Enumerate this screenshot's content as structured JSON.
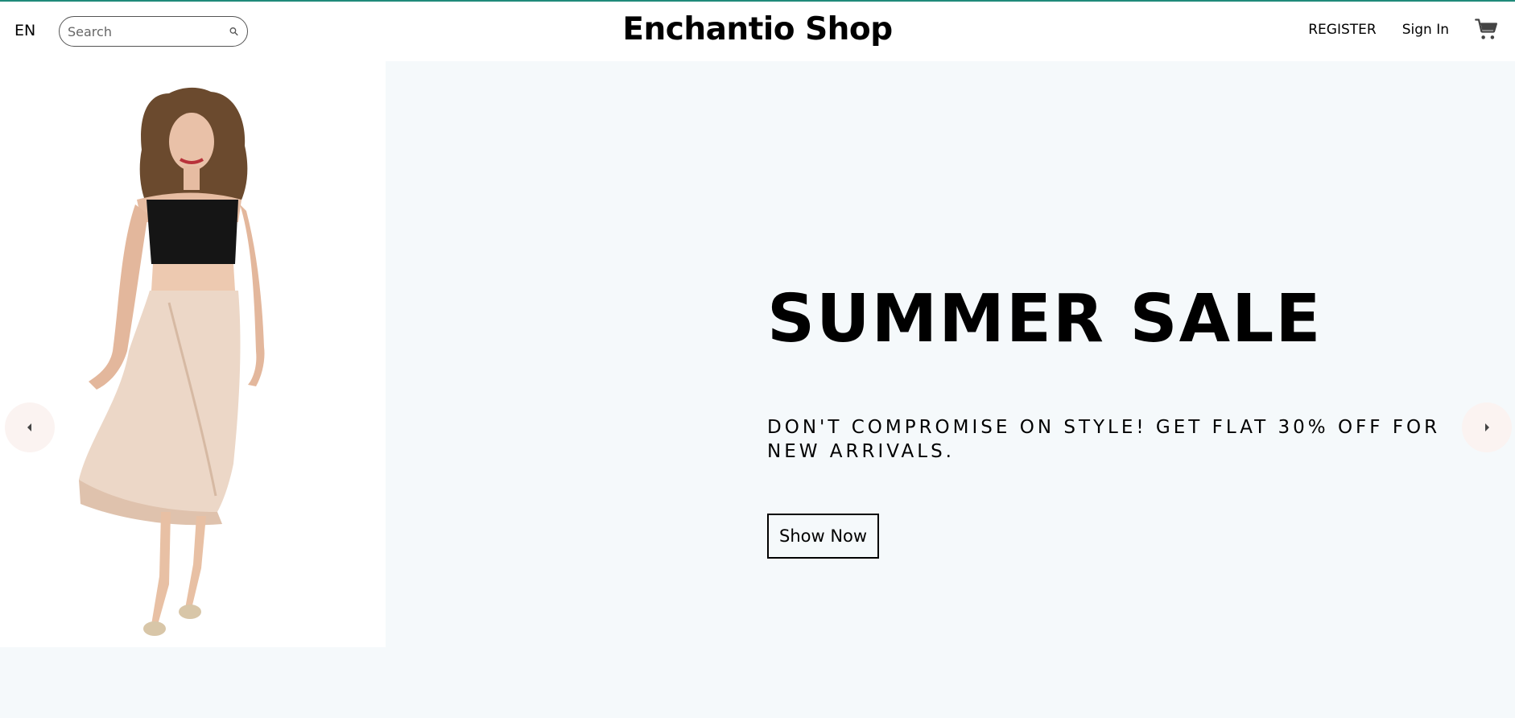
{
  "header": {
    "language": "EN",
    "search": {
      "placeholder": "Search",
      "value": ""
    },
    "brand": "Enchantio Shop",
    "register_label": "REGISTER",
    "signin_label": "Sign In",
    "accent_color": "#1f8a7a"
  },
  "slider": {
    "title": "SUMMER SALE",
    "description": "DON'T COMPROMISE ON STYLE! GET FLAT 30% OFF FOR NEW ARRIVALS.",
    "button_label": "Show Now",
    "background_color": "#f5f9fb",
    "arrow_color": "#fbf3f1",
    "icons": {
      "prev": "arrow-left-icon",
      "next": "arrow-right-icon"
    }
  }
}
